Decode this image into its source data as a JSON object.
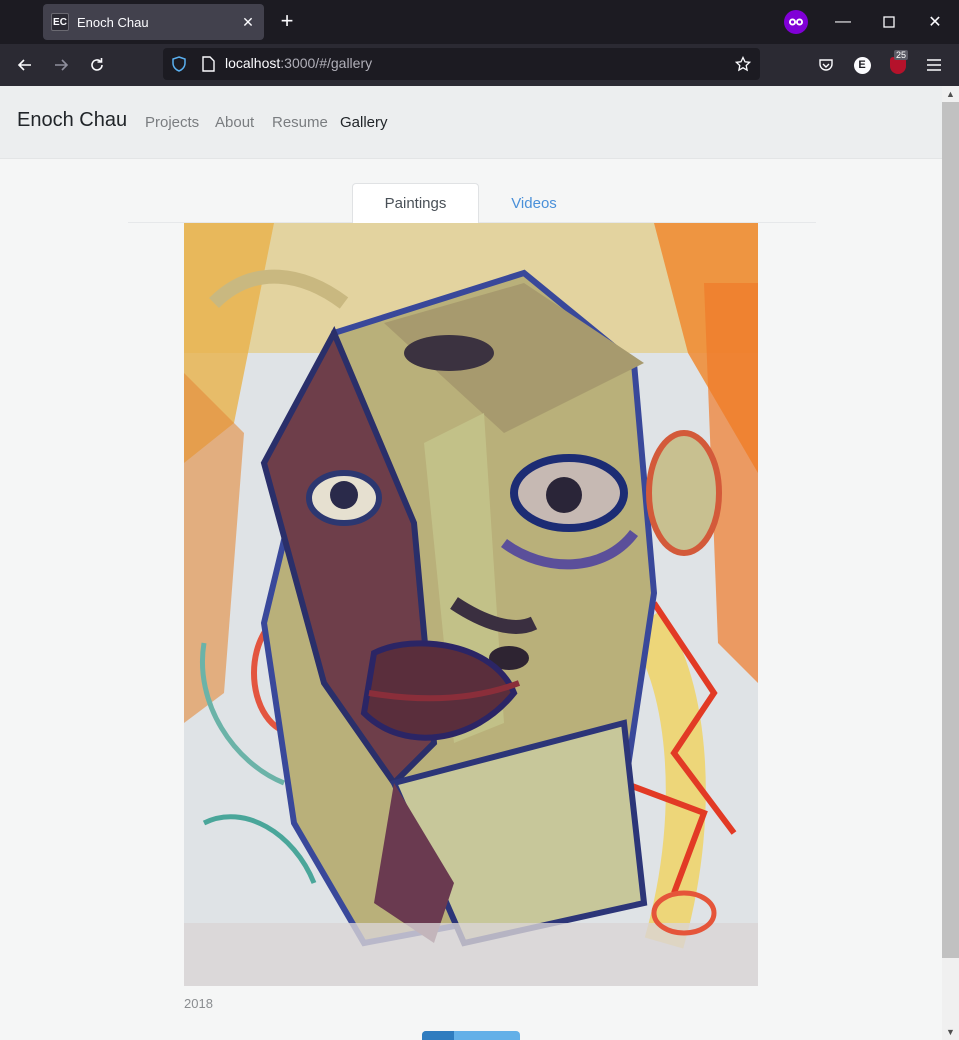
{
  "browser": {
    "tab_title": "Enoch Chau",
    "favicon_text": "EC",
    "url_host": "localhost",
    "url_rest": ":3000/#/gallery",
    "badge_count": "25",
    "extension_letter": "E"
  },
  "site": {
    "brand": "Enoch Chau",
    "nav": [
      "Projects",
      "About",
      "Resume",
      "Gallery"
    ],
    "active_nav": "Gallery"
  },
  "gallery": {
    "tabs": [
      "Paintings",
      "Videos"
    ],
    "active_tab": "Paintings",
    "caption": "2018",
    "carousel_progress": 0.33
  }
}
